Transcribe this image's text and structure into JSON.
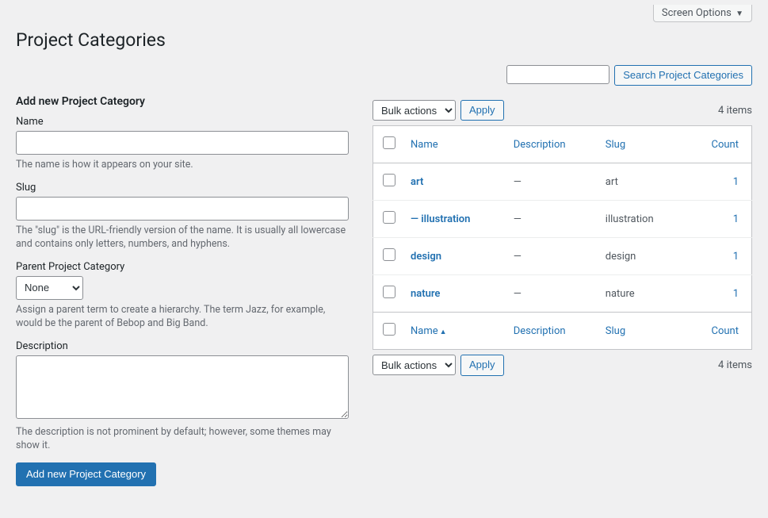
{
  "screen_options": "Screen Options",
  "page_title": "Project Categories",
  "search": {
    "placeholder": "",
    "button": "Search Project Categories"
  },
  "form": {
    "heading": "Add new Project Category",
    "name": {
      "label": "Name",
      "value": "",
      "help": "The name is how it appears on your site."
    },
    "slug": {
      "label": "Slug",
      "value": "",
      "help": "The \"slug\" is the URL-friendly version of the name. It is usually all lowercase and contains only letters, numbers, and hyphens."
    },
    "parent": {
      "label": "Parent Project Category",
      "selected": "None",
      "help": "Assign a parent term to create a hierarchy. The term Jazz, for example, would be the parent of Bebop and Big Band."
    },
    "description": {
      "label": "Description",
      "value": "",
      "help": "The description is not prominent by default; however, some themes may show it."
    },
    "submit": "Add new Project Category"
  },
  "bulk": {
    "label": "Bulk actions",
    "apply": "Apply"
  },
  "items_count": "4 items",
  "cols": {
    "name": "Name",
    "description": "Description",
    "slug": "Slug",
    "count": "Count"
  },
  "rows": [
    {
      "name": "art",
      "description": "—",
      "slug": "art",
      "count": "1"
    },
    {
      "name": "— illustration",
      "description": "—",
      "slug": "illustration",
      "count": "1"
    },
    {
      "name": "design",
      "description": "—",
      "slug": "design",
      "count": "1"
    },
    {
      "name": "nature",
      "description": "—",
      "slug": "nature",
      "count": "1"
    }
  ]
}
